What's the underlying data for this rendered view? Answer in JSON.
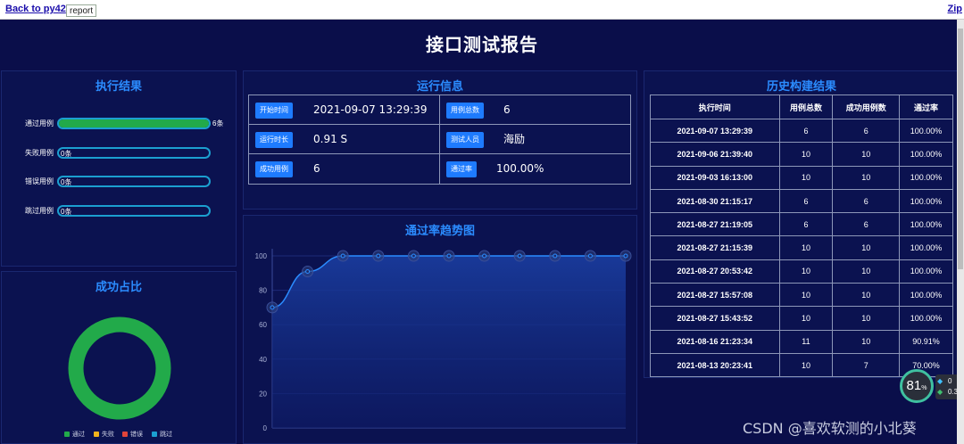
{
  "topbar": {
    "back_link": "Back to py42",
    "tab": "report",
    "zip_link": "Zip"
  },
  "page_title": "接口测试报告",
  "exec": {
    "title": "执行结果",
    "rows": [
      {
        "label": "通过用例",
        "value": "6条",
        "fraction": 1.0,
        "color": "#22aa4a"
      },
      {
        "label": "失败用例",
        "value": "0条",
        "fraction": 0
      },
      {
        "label": "错误用例",
        "value": "0条",
        "fraction": 0
      },
      {
        "label": "跳过用例",
        "value": "0条",
        "fraction": 0
      }
    ]
  },
  "ratio": {
    "title": "成功占比",
    "legend": [
      "通过",
      "失败",
      "错误",
      "跳过"
    ],
    "legend_colors": [
      "#22aa4a",
      "#f2b31c",
      "#e0443a",
      "#1b9fd0"
    ],
    "pass_fraction": 1.0
  },
  "run_info": {
    "title": "运行信息",
    "cells": [
      {
        "label": "开始时间",
        "value": "2021-09-07 13:29:39"
      },
      {
        "label": "用例总数",
        "value": "6"
      },
      {
        "label": "运行时长",
        "value": "0.91 S"
      },
      {
        "label": "测试人员",
        "value": "海励"
      },
      {
        "label": "成功用例",
        "value": "6"
      },
      {
        "label": "通过率",
        "value": "100.00%"
      }
    ]
  },
  "trend": {
    "title": "通过率趋势图"
  },
  "chart_data": {
    "type": "line",
    "title": "通过率趋势图",
    "x": [
      1,
      2,
      3,
      4,
      5,
      6,
      7,
      8,
      9,
      10,
      11
    ],
    "series": [
      {
        "values": [
          70,
          90.91,
          100,
          100,
          100,
          100,
          100,
          100,
          100,
          100,
          100
        ]
      }
    ],
    "yticks": [
      "0",
      "20",
      "40",
      "60",
      "80",
      "100"
    ],
    "ylim": [
      0,
      100
    ],
    "area": true,
    "grid": true
  },
  "history": {
    "title": "历史构建结果",
    "headers": [
      "执行时间",
      "用例总数",
      "成功用例数",
      "通过率"
    ],
    "rows": [
      [
        "2021-09-07 13:29:39",
        "6",
        "6",
        "100.00%"
      ],
      [
        "2021-09-06 21:39:40",
        "10",
        "10",
        "100.00%"
      ],
      [
        "2021-09-03 16:13:00",
        "10",
        "10",
        "100.00%"
      ],
      [
        "2021-08-30 21:15:17",
        "6",
        "6",
        "100.00%"
      ],
      [
        "2021-08-27 21:19:05",
        "6",
        "6",
        "100.00%"
      ],
      [
        "2021-08-27 21:15:39",
        "10",
        "10",
        "100.00%"
      ],
      [
        "2021-08-27 20:53:42",
        "10",
        "10",
        "100.00%"
      ],
      [
        "2021-08-27 15:57:08",
        "10",
        "10",
        "100.00%"
      ],
      [
        "2021-08-27 15:43:52",
        "10",
        "10",
        "100.00%"
      ],
      [
        "2021-08-16 21:23:34",
        "11",
        "10",
        "90.91%"
      ],
      [
        "2021-08-13 20:23:41",
        "10",
        "7",
        "70.00%"
      ]
    ]
  },
  "watermark": "CSDN @喜欢软测的小北葵",
  "speed_widget": {
    "percent": "81",
    "unit": "%",
    "line1": "0",
    "line2": "0.3"
  }
}
